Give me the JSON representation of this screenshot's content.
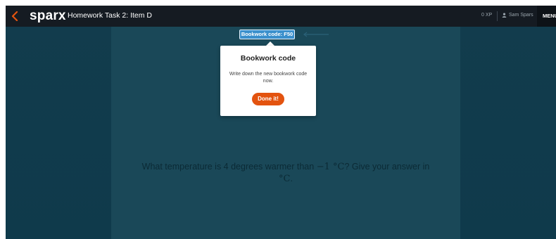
{
  "header": {
    "logo_text": "sparx",
    "task_title": "Homework Task 2: Item D",
    "xp": "0 XP",
    "user_name": "Sam Spars",
    "menu_label": "MENU"
  },
  "bookwork_badge": {
    "label": "Bookwork code: F50"
  },
  "popup": {
    "title": "Bookwork code",
    "message": "Write down the new bookwork code now.",
    "done_label": "Done it!"
  },
  "question": {
    "text_before": "What temperature is 4 degrees warmer than ",
    "math_value": "−1 °C",
    "text_after": "? Give your answer in ",
    "unit": "°C",
    "end": "."
  },
  "colors": {
    "topbar": "#151b22",
    "background": "#0f3a4b",
    "panel": "#1a4858",
    "accent_orange": "#e3530f",
    "badge_blue": "#3a8fcc"
  },
  "icons": {
    "back": "chevron-left-icon",
    "user": "user-icon",
    "arrow_hint": "arrow-left-icon"
  }
}
